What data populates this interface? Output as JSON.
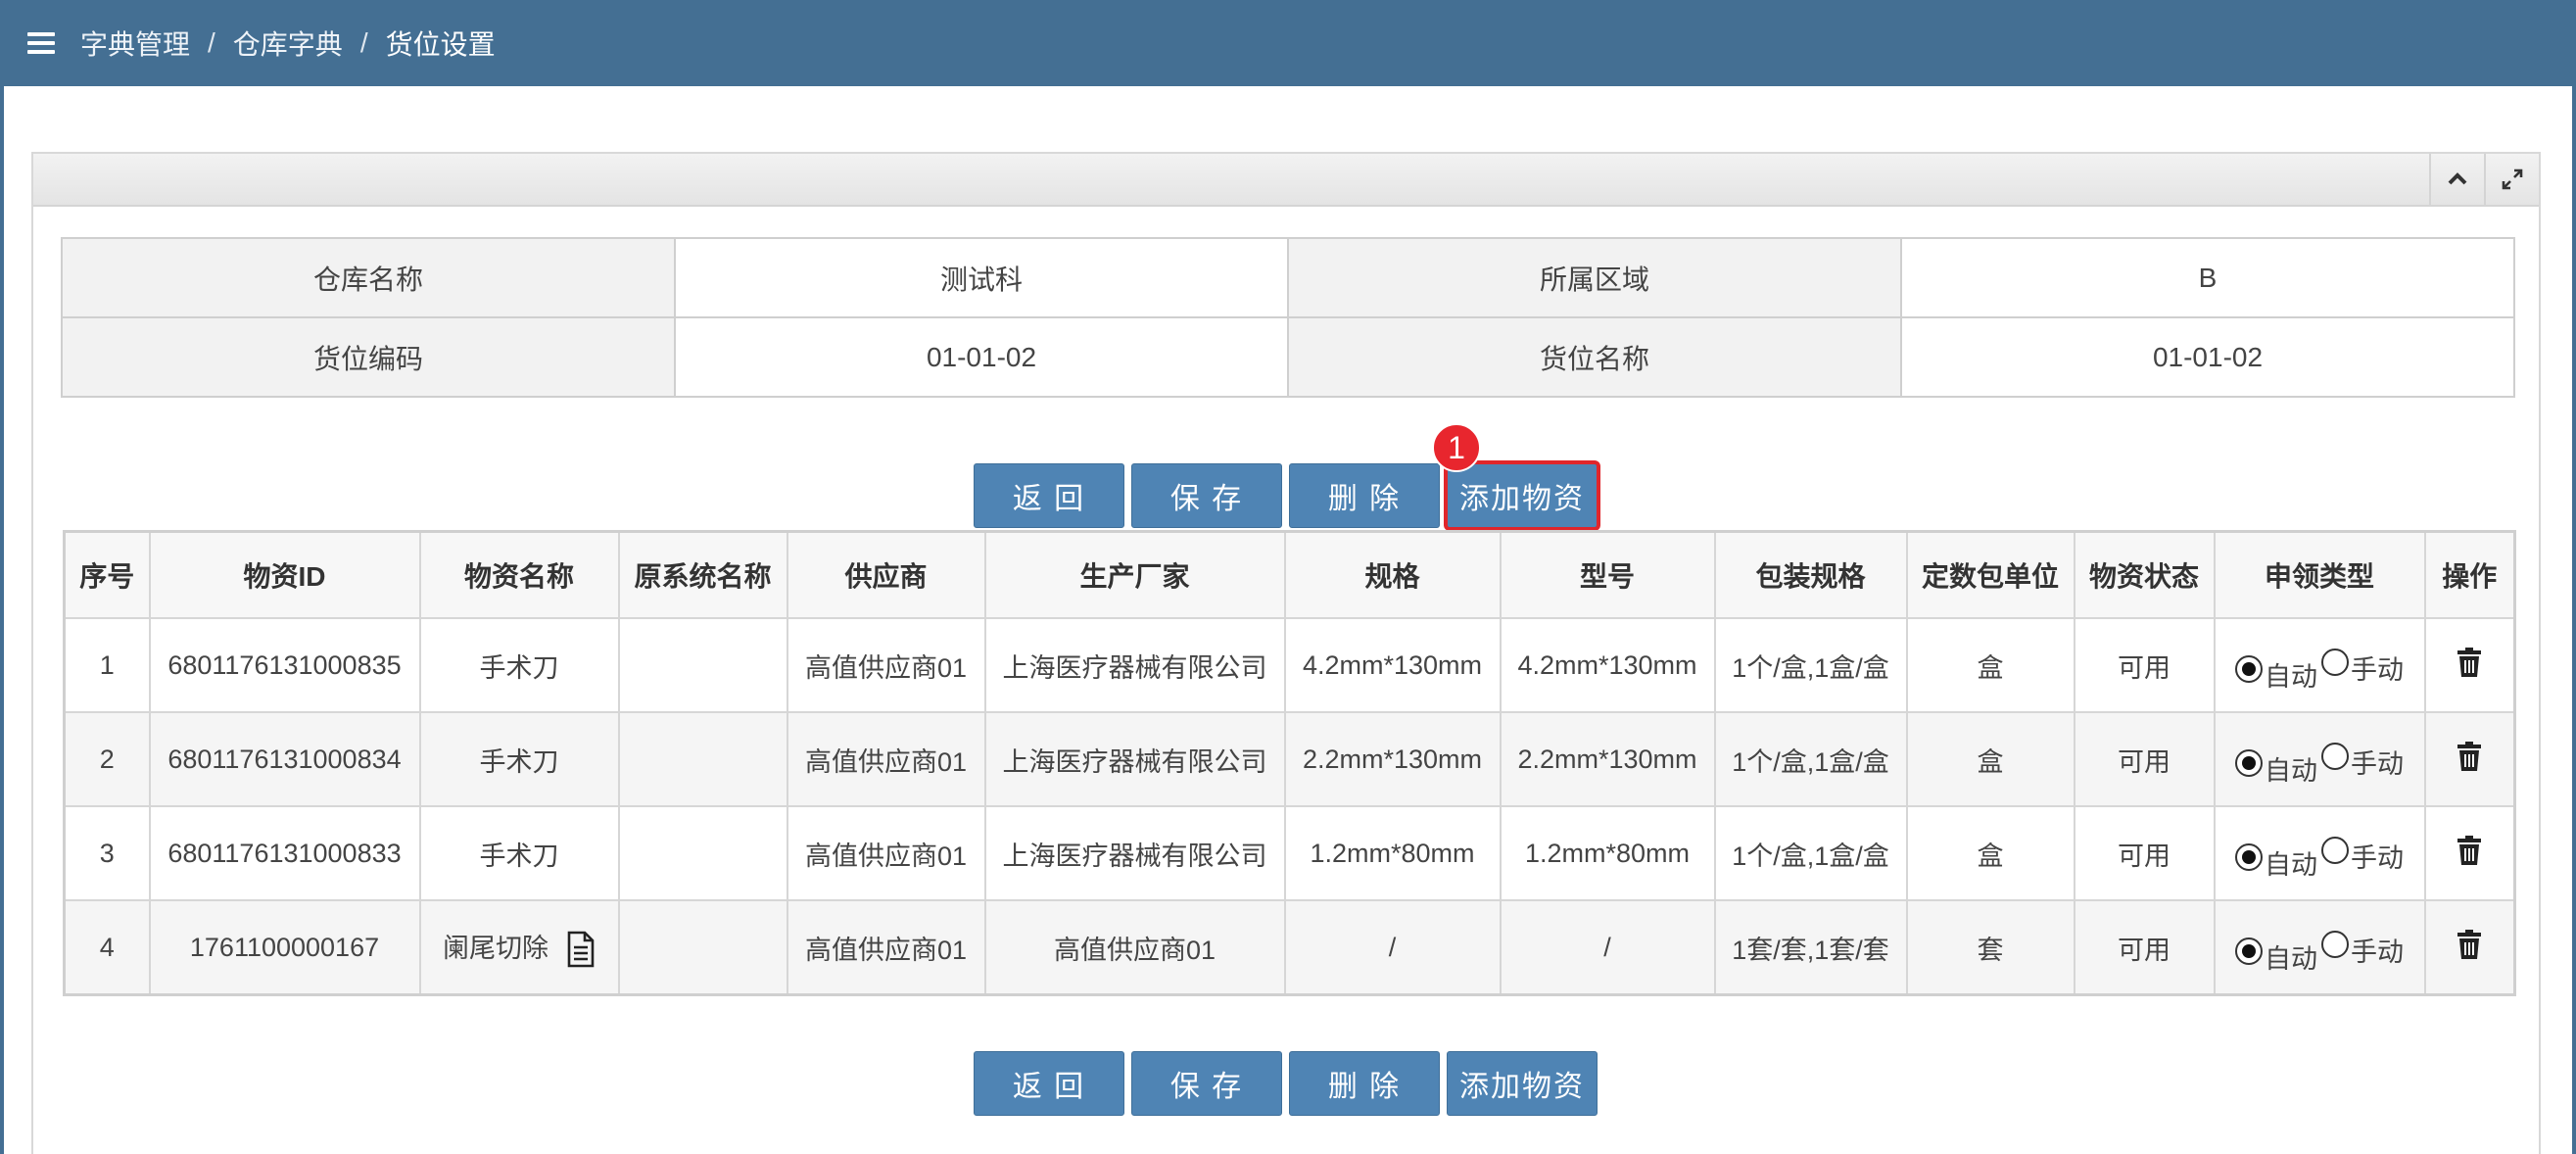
{
  "breadcrumb": [
    "字典管理",
    "仓库字典",
    "货位设置"
  ],
  "breadcrumb_sep": "/",
  "info": {
    "warehouse_label": "仓库名称",
    "warehouse_value": "测试科",
    "area_label": "所属区域",
    "area_value": "B",
    "code_label": "货位编码",
    "code_value": "01-01-02",
    "name_label": "货位名称",
    "name_value": "01-01-02"
  },
  "buttons": {
    "back": "返 回",
    "save": "保 存",
    "delete": "删 除",
    "add": "添加物资"
  },
  "badge": "1",
  "table": {
    "headers": [
      "序号",
      "物资ID",
      "物资名称",
      "原系统名称",
      "供应商",
      "生产厂家",
      "规格",
      "型号",
      "包装规格",
      "定数包单位",
      "物资状态",
      "申领类型",
      "操作"
    ],
    "radio_auto": "自动",
    "radio_manual": "手动",
    "rows": [
      {
        "no": "1",
        "id": "6801176131000835",
        "name": "手术刀",
        "orig": "",
        "supplier": "高值供应商01",
        "maker": "上海医疗器械有限公司",
        "spec": "4.2mm*130mm",
        "model": "4.2mm*130mm",
        "pack": "1个/盒,1盒/盒",
        "unit": "盒",
        "status": "可用"
      },
      {
        "no": "2",
        "id": "6801176131000834",
        "name": "手术刀",
        "orig": "",
        "supplier": "高值供应商01",
        "maker": "上海医疗器械有限公司",
        "spec": "2.2mm*130mm",
        "model": "2.2mm*130mm",
        "pack": "1个/盒,1盒/盒",
        "unit": "盒",
        "status": "可用"
      },
      {
        "no": "3",
        "id": "6801176131000833",
        "name": "手术刀",
        "orig": "",
        "supplier": "高值供应商01",
        "maker": "上海医疗器械有限公司",
        "spec": "1.2mm*80mm",
        "model": "1.2mm*80mm",
        "pack": "1个/盒,1盒/盒",
        "unit": "盒",
        "status": "可用"
      },
      {
        "no": "4",
        "id": "1761100000167",
        "name": "阑尾切除",
        "orig": "",
        "supplier": "高值供应商01",
        "maker": "高值供应商01",
        "spec": "/",
        "model": "/",
        "pack": "1套/套,1套/套",
        "unit": "套",
        "status": "可用"
      }
    ]
  },
  "colors": {
    "header": "#446f93",
    "button": "#4f84b4",
    "highlight": "#e0262b"
  }
}
